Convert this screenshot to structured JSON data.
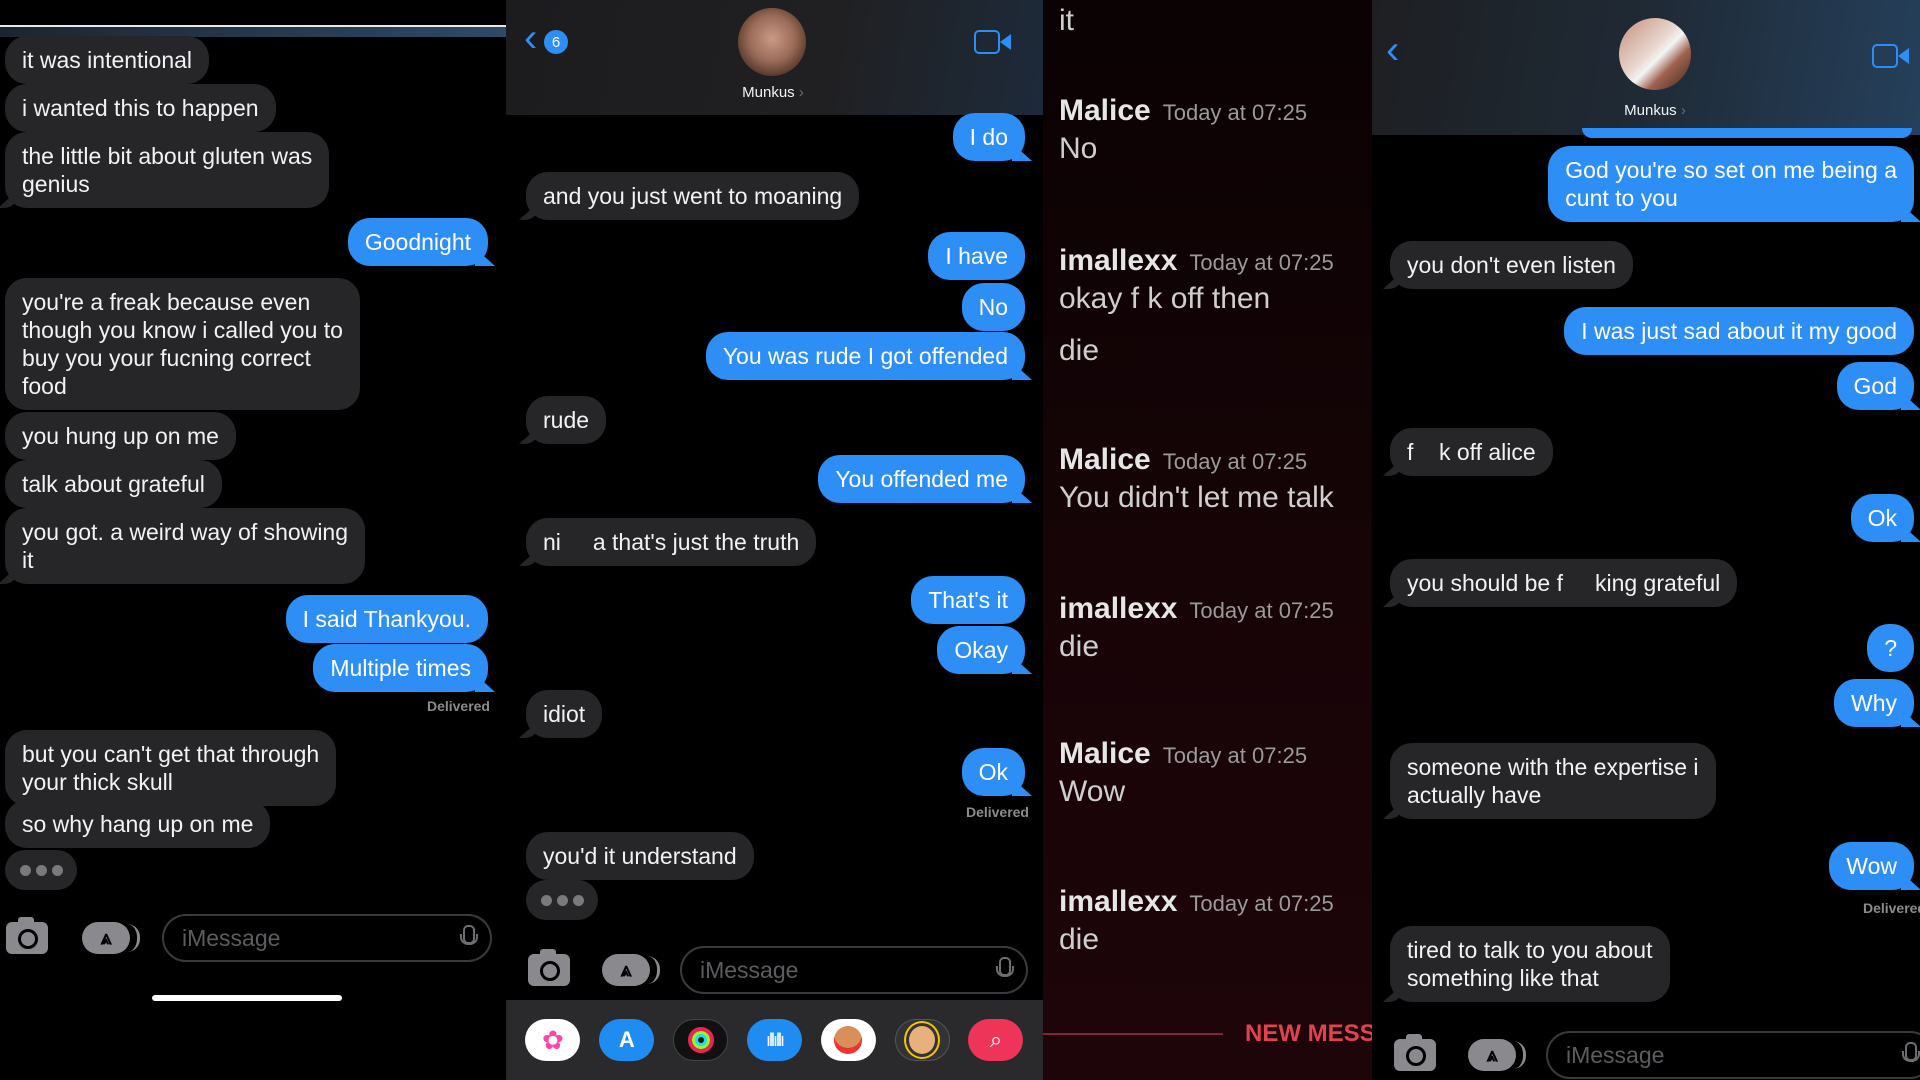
{
  "panel1": {
    "messages": [
      {
        "dir": "in",
        "text": "it was intentional"
      },
      {
        "dir": "in",
        "text": "i wanted this to happen"
      },
      {
        "dir": "in",
        "text": "the little bit about gluten was\ngenius"
      },
      {
        "dir": "out",
        "text": "Goodnight"
      },
      {
        "dir": "in",
        "text": "you're a freak because even\nthough you know i called you to\nbuy you your fucning correct\nfood"
      },
      {
        "dir": "in",
        "text": "you hung up on me"
      },
      {
        "dir": "in",
        "text": "talk about grateful"
      },
      {
        "dir": "in",
        "text": "you got. a weird way of showing\nit"
      },
      {
        "dir": "out",
        "text": "I said Thankyou."
      },
      {
        "dir": "out",
        "text": "Multiple times"
      },
      {
        "dir": "in",
        "text": "but you can't get that through\nyour thick skull"
      },
      {
        "dir": "in",
        "text": "so why hang up on me"
      }
    ],
    "status": "Delivered",
    "input_placeholder": "iMessage"
  },
  "panel2": {
    "header": {
      "back_badge": "6",
      "contact_name": "Munkus",
      "chevron": "›"
    },
    "messages": [
      {
        "dir": "out",
        "text": "I do"
      },
      {
        "dir": "in",
        "text": "and you just went to moaning"
      },
      {
        "dir": "out",
        "text": "I have"
      },
      {
        "dir": "out",
        "text": "No"
      },
      {
        "dir": "out",
        "text": "You was rude I got offended"
      },
      {
        "dir": "in",
        "text": "rude"
      },
      {
        "dir": "out",
        "text": "You offended me"
      },
      {
        "dir": "in",
        "text": "ni     a that's just the truth"
      },
      {
        "dir": "out",
        "text": "That's it"
      },
      {
        "dir": "out",
        "text": "Okay"
      },
      {
        "dir": "in",
        "text": "idiot"
      },
      {
        "dir": "out",
        "text": "Ok"
      },
      {
        "dir": "in",
        "text": "you'd it understand"
      }
    ],
    "status": "Delivered",
    "input_placeholder": "iMessage",
    "app_drawer": [
      "photos-app",
      "app-store",
      "activity-rings",
      "audio-message",
      "memoji-stickers",
      "animoji",
      "web-images-search"
    ]
  },
  "panel3": {
    "top_fragment": "it",
    "messages": [
      {
        "user": "Malice",
        "time": "Today at 07:25",
        "lines": [
          "No"
        ]
      },
      {
        "user": "imallexx",
        "time": "Today at 07:25",
        "lines": [
          "okay f     k off then",
          "die"
        ]
      },
      {
        "user": "Malice",
        "time": "Today at 07:25",
        "lines": [
          "You didn't let me talk"
        ]
      },
      {
        "user": "imallexx",
        "time": "Today at 07:25",
        "lines": [
          "die"
        ]
      },
      {
        "user": "Malice",
        "time": "Today at 07:25",
        "lines": [
          "Wow"
        ]
      },
      {
        "user": "imallexx",
        "time": "Today at 07:25",
        "lines": [
          "die"
        ]
      }
    ],
    "new_messages_label": "NEW MESS",
    "accent": "#e0434d"
  },
  "panel4": {
    "header": {
      "contact_name": "Munkus",
      "chevron": "›"
    },
    "messages": [
      {
        "dir": "out",
        "text": "God you're so set on me being a\ncunt to you"
      },
      {
        "dir": "in",
        "text": "you don't even listen"
      },
      {
        "dir": "out",
        "text": "I was just sad about it my good"
      },
      {
        "dir": "out",
        "text": "God"
      },
      {
        "dir": "in",
        "text": "f    k off alice"
      },
      {
        "dir": "out",
        "text": "Ok"
      },
      {
        "dir": "in",
        "text": "you should be f     king grateful"
      },
      {
        "dir": "out",
        "text": "?"
      },
      {
        "dir": "out",
        "text": "Why"
      },
      {
        "dir": "in",
        "text": "someone with the expertise i\nactually have"
      },
      {
        "dir": "out",
        "text": "Wow"
      },
      {
        "dir": "in",
        "text": "tired to talk to you about\nsomething like that"
      }
    ],
    "status": "Delivered",
    "input_placeholder": "iMessage"
  },
  "colors": {
    "outgoing_bubble": "#2d8ef5",
    "incoming_bubble": "#262629",
    "background": "#000000"
  }
}
